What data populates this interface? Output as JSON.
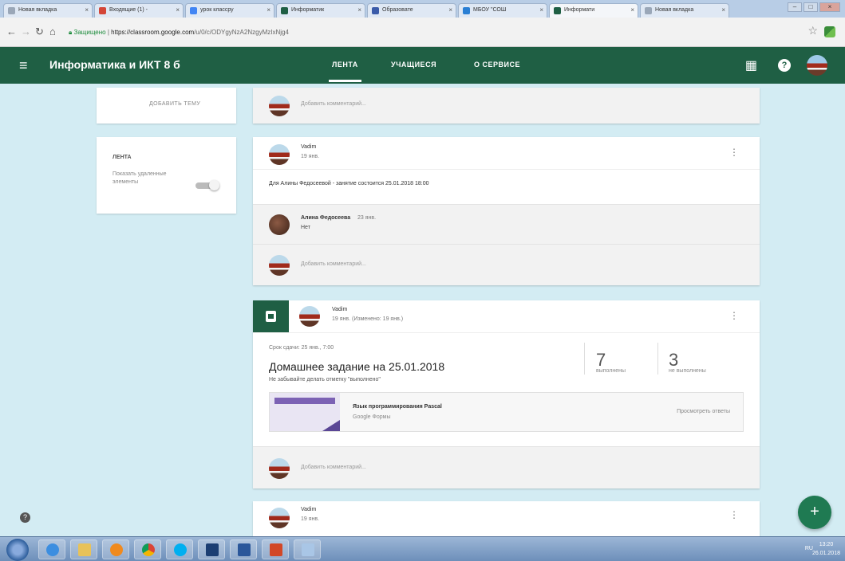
{
  "browser": {
    "tabs": [
      {
        "label": "Новая вкладка",
        "color": "#9aa7b8"
      },
      {
        "label": "Входящие (1) -",
        "color": "#d44638"
      },
      {
        "label": "урок классру",
        "color": "#4285f4"
      },
      {
        "label": "Информатик",
        "color": "#1f5f44"
      },
      {
        "label": "Образовате",
        "color": "#3b5ba9"
      },
      {
        "label": "МБОУ \"СОШ",
        "color": "#2a7fd4"
      },
      {
        "label": "Информати",
        "color": "#1f5f44"
      },
      {
        "label": "Новая вкладка",
        "color": "#9aa7b8"
      }
    ],
    "active_tab_index": 6,
    "url_secure": "Защищено",
    "url_host": "https://classroom.google.com",
    "url_path": "/u/0/c/ODYgyNzA2NzgyMzIxNjg4"
  },
  "header": {
    "class_title": "Информатика и ИКТ 8 б",
    "tabs": [
      "ЛЕНТА",
      "УЧАЩИЕСЯ",
      "О СЕРВИСЕ"
    ],
    "active_tab": "ЛЕНТА"
  },
  "sidebar": {
    "add_topic": "ДОБАВИТЬ ТЕМУ",
    "stream_title": "ЛЕНТА",
    "show_deleted_label": "Показать удаленные элементы"
  },
  "stream": {
    "comment_placeholder": "Добавить комментарий...",
    "post1": {
      "author": "Vadim",
      "date": "19 янв.",
      "text": "Для Алины Федосеевой - занятие состоится 25.01.2018 18:00",
      "reply_author": "Алина Федосеева",
      "reply_date": "23 янв.",
      "reply_text": "Нет"
    },
    "assignment": {
      "author": "Vadim",
      "date": "19 янв. (Изменено: 19 янв.)",
      "due": "Срок сдачи: 25 янв., 7:00",
      "title": "Домашнее задание на 25.01.2018",
      "description": "Не забывайте делать отметку \"выполнено\"",
      "done_count": "7",
      "done_label": "выполнены",
      "not_done_count": "3",
      "not_done_label": "не выполнены",
      "attachment_title": "Язык программирования Pascal",
      "attachment_type": "Google Формы",
      "view_answers": "Просмотреть ответы"
    },
    "post3": {
      "author": "Vadim",
      "date": "19 янв."
    }
  },
  "taskbar": {
    "tray_lang": "RU",
    "time": "13:20",
    "date": "26.01.2018"
  },
  "colors": {
    "classroom_green": "#1f5f44",
    "background": "#d3ecf3",
    "fab": "#1f7a52"
  },
  "icons": {
    "fab": "+",
    "menu": "≡",
    "apps": "⋮⋮⋮",
    "kebab": "⋮",
    "help": "?"
  }
}
